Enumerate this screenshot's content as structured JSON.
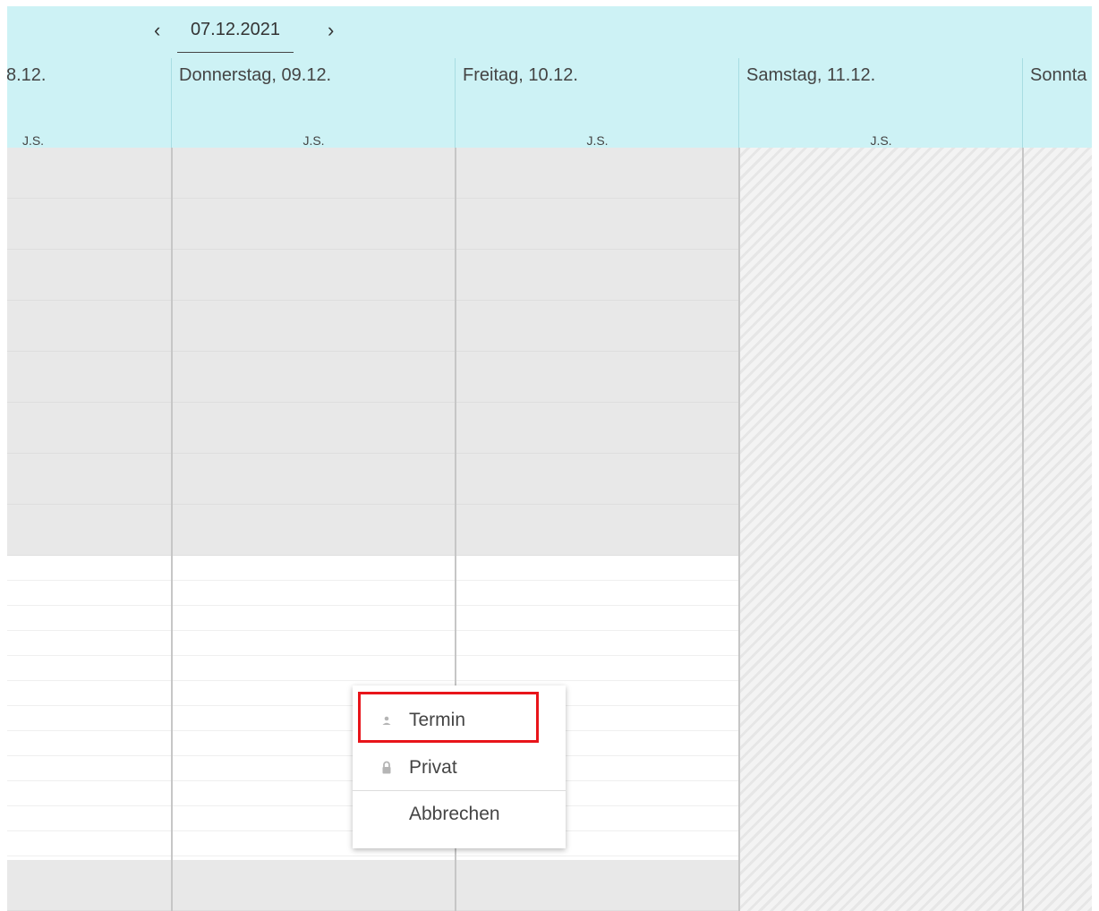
{
  "header": {
    "prev_label": "‹",
    "next_label": "›",
    "current_date": "07.12.2021",
    "days": [
      {
        "label": "8.12.",
        "initials": "J.S."
      },
      {
        "label": "Donnerstag, 09.12.",
        "initials": "J.S."
      },
      {
        "label": "Freitag, 10.12.",
        "initials": "J.S."
      },
      {
        "label": "Samstag, 11.12.",
        "initials": "J.S."
      },
      {
        "label": "Sonnta",
        "initials": ""
      }
    ]
  },
  "context_menu": {
    "items": [
      {
        "label": "Termin",
        "icon": "person-icon"
      },
      {
        "label": "Privat",
        "icon": "lock-icon"
      },
      {
        "label": "Abbrechen",
        "icon": ""
      }
    ]
  },
  "colors": {
    "header_bg": "#cdf2f5",
    "highlight": "#e8141a"
  }
}
